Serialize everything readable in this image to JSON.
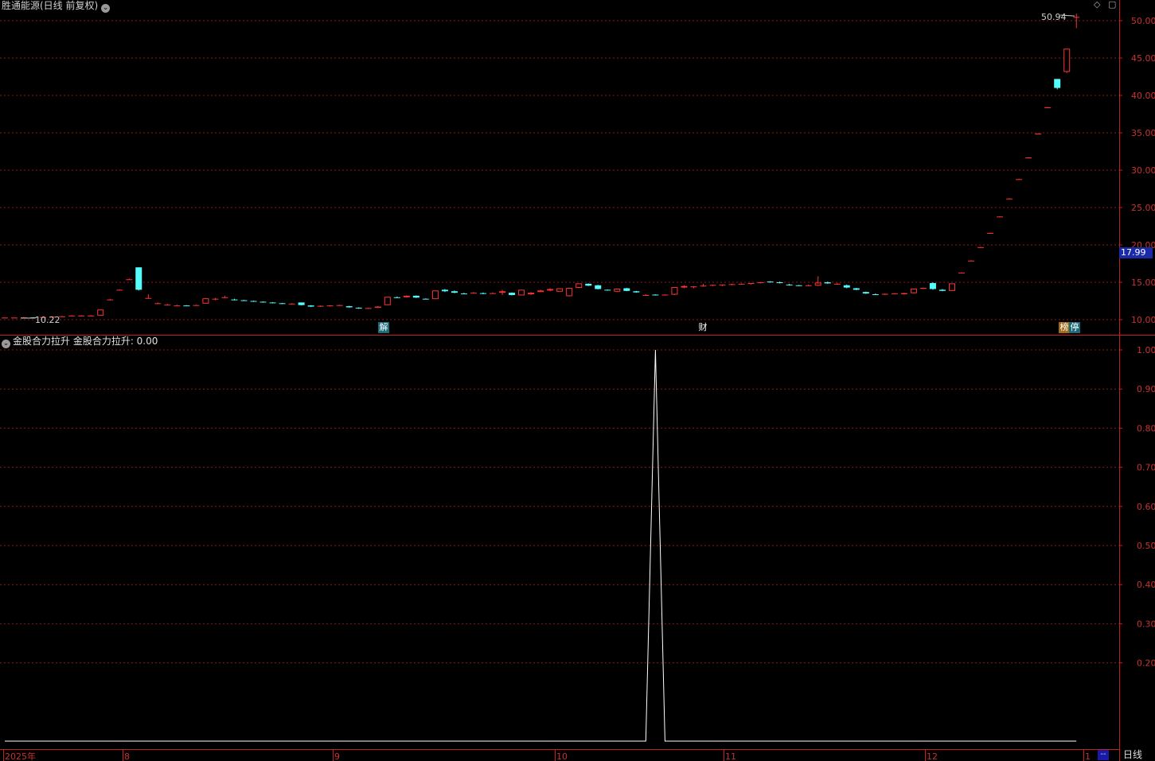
{
  "header": {
    "stock_title": "胜通能源(日线 前复权)",
    "indicator_title": "金股合力拉升 金股合力拉升: 0.00"
  },
  "events": {
    "e1": "解",
    "e2": "财",
    "e3": "榜",
    "e4": "停"
  },
  "price_now_label": "17.99",
  "buttons": {
    "daily": "日线",
    "dash": "--"
  },
  "colors": {
    "up": "#ff3232",
    "down": "#54fcfc",
    "grid": "#8b1a1a",
    "axis": "#c81e1e",
    "line": "#ffffff",
    "label_bg": "#1a2aa8"
  },
  "chart_data": [
    {
      "type": "candlestick",
      "title": "胜通能源(日线 前复权)",
      "ylim": [
        9.5,
        51.5
      ],
      "y_ticks": [
        "10.00",
        "15.00",
        "20.00",
        "25.00",
        "30.00",
        "35.00",
        "40.00",
        "45.00",
        "50.00"
      ],
      "annotations": {
        "high": "50.94",
        "low": "10.22",
        "current": "17.99"
      },
      "x_ticks": [
        "2025年",
        "8",
        "9",
        "10",
        "11",
        "12",
        "1"
      ],
      "candles_ohlc": [
        [
          10.25,
          10.3,
          10.2,
          10.28
        ],
        [
          10.28,
          10.3,
          10.22,
          10.28
        ],
        [
          10.3,
          10.35,
          10.25,
          10.3
        ],
        [
          10.3,
          10.33,
          10.22,
          10.28
        ],
        [
          10.3,
          10.4,
          10.25,
          10.35
        ],
        [
          10.3,
          10.45,
          10.25,
          10.4
        ],
        [
          10.4,
          10.5,
          10.35,
          10.45
        ],
        [
          10.5,
          10.6,
          10.45,
          10.55
        ],
        [
          10.5,
          10.6,
          10.45,
          10.55
        ],
        [
          10.5,
          10.6,
          10.45,
          10.55
        ],
        [
          10.6,
          11.3,
          10.6,
          11.3
        ],
        [
          12.7,
          12.8,
          12.6,
          12.7
        ],
        [
          14.0,
          14.05,
          13.95,
          14.0
        ],
        [
          15.4,
          15.5,
          15.35,
          15.4
        ],
        [
          17.0,
          17.0,
          13.9,
          14.0
        ],
        [
          12.9,
          13.4,
          12.8,
          12.9
        ],
        [
          12.2,
          12.3,
          12.1,
          12.2
        ],
        [
          12.0,
          12.1,
          11.95,
          12.0
        ],
        [
          11.9,
          12.0,
          11.85,
          11.9
        ],
        [
          11.9,
          11.95,
          11.85,
          11.88
        ],
        [
          11.9,
          12.0,
          11.85,
          11.95
        ],
        [
          12.2,
          12.9,
          12.2,
          12.8
        ],
        [
          12.7,
          12.9,
          12.6,
          12.8
        ],
        [
          13.0,
          13.2,
          12.9,
          13.0
        ],
        [
          12.7,
          12.8,
          12.6,
          12.65
        ],
        [
          12.6,
          12.65,
          12.5,
          12.55
        ],
        [
          12.5,
          12.55,
          12.4,
          12.45
        ],
        [
          12.4,
          12.45,
          12.3,
          12.35
        ],
        [
          12.3,
          12.35,
          12.2,
          12.25
        ],
        [
          12.2,
          12.25,
          12.1,
          12.15
        ],
        [
          12.1,
          12.2,
          12.05,
          12.15
        ],
        [
          12.3,
          12.3,
          11.9,
          11.95
        ],
        [
          11.9,
          11.95,
          11.7,
          11.75
        ],
        [
          11.8,
          11.9,
          11.7,
          11.85
        ],
        [
          11.8,
          11.95,
          11.75,
          11.9
        ],
        [
          11.9,
          12.0,
          11.85,
          11.95
        ],
        [
          11.8,
          11.85,
          11.6,
          11.65
        ],
        [
          11.6,
          11.65,
          11.45,
          11.5
        ],
        [
          11.55,
          11.6,
          11.45,
          11.55
        ],
        [
          11.6,
          11.8,
          11.55,
          11.75
        ],
        [
          12.0,
          13.0,
          11.95,
          13.0
        ],
        [
          13.0,
          13.1,
          12.9,
          12.95
        ],
        [
          13.0,
          13.25,
          12.95,
          13.2
        ],
        [
          13.2,
          13.25,
          12.9,
          12.95
        ],
        [
          12.8,
          12.85,
          12.7,
          12.75
        ],
        [
          12.8,
          13.9,
          12.75,
          13.85
        ],
        [
          14.0,
          14.1,
          13.7,
          13.8
        ],
        [
          13.8,
          13.9,
          13.55,
          13.6
        ],
        [
          13.5,
          13.6,
          13.4,
          13.45
        ],
        [
          13.6,
          13.7,
          13.5,
          13.6
        ],
        [
          13.55,
          13.65,
          13.4,
          13.5
        ],
        [
          13.5,
          13.65,
          13.45,
          13.55
        ],
        [
          13.6,
          14.0,
          13.3,
          13.8
        ],
        [
          13.6,
          13.65,
          13.25,
          13.3
        ],
        [
          13.3,
          14.0,
          13.25,
          13.95
        ],
        [
          13.4,
          13.7,
          13.3,
          13.6
        ],
        [
          13.7,
          14.0,
          13.7,
          13.9
        ],
        [
          13.9,
          14.2,
          13.8,
          14.1
        ],
        [
          13.8,
          14.2,
          13.8,
          14.15
        ],
        [
          13.2,
          14.3,
          13.1,
          14.2
        ],
        [
          14.3,
          14.8,
          14.2,
          14.8
        ],
        [
          14.8,
          14.85,
          14.5,
          14.55
        ],
        [
          14.6,
          14.65,
          14.05,
          14.1
        ],
        [
          14.0,
          14.05,
          13.9,
          13.95
        ],
        [
          13.8,
          14.1,
          13.7,
          14.1
        ],
        [
          14.2,
          14.25,
          13.8,
          13.85
        ],
        [
          13.8,
          13.85,
          13.6,
          13.65
        ],
        [
          13.3,
          13.4,
          13.2,
          13.3
        ],
        [
          13.35,
          13.4,
          13.25,
          13.3
        ],
        [
          13.3,
          13.4,
          13.25,
          13.35
        ],
        [
          13.4,
          14.3,
          13.3,
          14.3
        ],
        [
          14.3,
          14.6,
          14.2,
          14.5
        ],
        [
          14.4,
          14.5,
          14.2,
          14.45
        ],
        [
          14.5,
          14.8,
          14.4,
          14.55
        ],
        [
          14.6,
          14.7,
          14.5,
          14.65
        ],
        [
          14.6,
          14.7,
          14.5,
          14.7
        ],
        [
          14.7,
          14.8,
          14.6,
          14.75
        ],
        [
          14.8,
          14.85,
          14.7,
          14.8
        ],
        [
          14.8,
          14.9,
          14.7,
          14.9
        ],
        [
          14.9,
          15.0,
          14.85,
          15.0
        ],
        [
          15.1,
          15.15,
          14.95,
          15.0
        ],
        [
          15.0,
          15.1,
          14.85,
          14.9
        ],
        [
          14.7,
          14.8,
          14.55,
          14.6
        ],
        [
          14.6,
          14.65,
          14.5,
          14.55
        ],
        [
          14.6,
          14.7,
          14.5,
          14.6
        ],
        [
          14.6,
          15.8,
          14.5,
          14.9
        ],
        [
          15.0,
          15.1,
          14.8,
          14.85
        ],
        [
          14.8,
          14.9,
          14.7,
          14.8
        ],
        [
          14.6,
          14.7,
          14.2,
          14.3
        ],
        [
          14.2,
          14.25,
          13.95,
          14.0
        ],
        [
          13.7,
          13.75,
          13.45,
          13.5
        ],
        [
          13.4,
          13.5,
          13.3,
          13.35
        ],
        [
          13.4,
          13.5,
          13.3,
          13.45
        ],
        [
          13.5,
          13.55,
          13.4,
          13.5
        ],
        [
          13.4,
          13.6,
          13.35,
          13.55
        ],
        [
          13.6,
          14.1,
          13.5,
          14.1
        ],
        [
          14.2,
          14.3,
          14.1,
          14.25
        ],
        [
          14.9,
          15.0,
          14.0,
          14.1
        ],
        [
          14.0,
          14.1,
          13.8,
          13.85
        ],
        [
          13.9,
          14.8,
          13.85,
          14.8
        ],
        [
          16.3,
          16.35,
          16.25,
          16.3
        ],
        [
          17.9,
          17.95,
          17.85,
          17.9
        ],
        [
          19.7,
          19.75,
          19.65,
          19.7
        ],
        [
          21.6,
          21.65,
          21.55,
          21.6
        ],
        [
          23.8,
          23.85,
          23.75,
          23.8
        ],
        [
          26.2,
          26.25,
          26.15,
          26.2
        ],
        [
          28.8,
          28.85,
          28.75,
          28.8
        ],
        [
          31.7,
          31.75,
          31.65,
          31.7
        ],
        [
          34.9,
          34.95,
          34.85,
          34.9
        ],
        [
          38.4,
          38.45,
          38.35,
          38.4
        ],
        [
          42.2,
          42.2,
          40.8,
          41.0
        ],
        [
          43.2,
          46.2,
          43.0,
          46.2
        ],
        [
          50.5,
          50.94,
          49.0,
          50.5
        ]
      ]
    },
    {
      "type": "line",
      "title": "金股合力拉升",
      "series": [
        {
          "name": "金股合力拉升",
          "values": "0 everywhere except 1.00 at spike"
        }
      ],
      "ylim": [
        0.0,
        1.04
      ],
      "y_ticks": [
        "1.00",
        "0.90",
        "0.80",
        "0.70",
        "0.60",
        "0.50",
        "0.40",
        "0.30",
        "0.20"
      ],
      "spike_index": 68,
      "spike_value": 1.0,
      "n_points": 113
    }
  ]
}
